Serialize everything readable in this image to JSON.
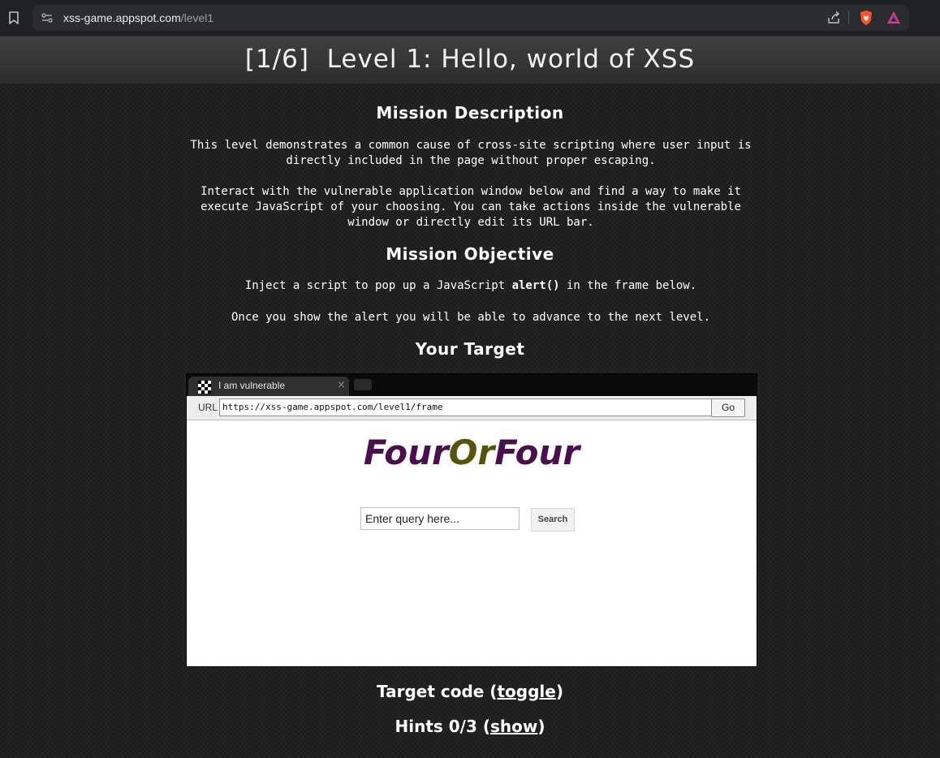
{
  "browser": {
    "url_host": "xss-game.appspot.com",
    "url_path": "/level1"
  },
  "page": {
    "title": "[1/6]  Level 1: Hello, world of XSS",
    "mission_description": {
      "heading": "Mission Description",
      "para1": "This level demonstrates a common cause of cross-site scripting where user input is directly included in the page without proper escaping.",
      "para2": "Interact with the vulnerable application window below and find a way to make it execute JavaScript of your choosing. You can take actions inside the vulnerable window or directly edit its URL bar."
    },
    "mission_objective": {
      "heading": "Mission Objective",
      "para1_before": "Inject a script to pop up a JavaScript ",
      "para1_code": "alert()",
      "para1_after": " in the frame below.",
      "para2": "Once you show the alert you will be able to advance to the next level."
    },
    "target_heading": "Your Target",
    "target_code_label": "Target code (",
    "target_code_link": "toggle",
    "target_code_end": ")",
    "hints_label": "Hints 0/3 (",
    "hints_link": "show",
    "hints_end": ")"
  },
  "frame": {
    "tab_title": "I am vulnerable",
    "tab_close": "×",
    "url_label": "URL",
    "url_value": "https://xss-game.appspot.com/level1/frame",
    "go_label": "Go",
    "logo_part1": "Four",
    "logo_part2": "Or",
    "logo_part3": "Four",
    "query_placeholder": "Enter query here...",
    "search_label": "Search"
  },
  "colors": {
    "logo_purple": "#4a0f4d",
    "logo_olive": "#555510",
    "brave_orange": "#fb542b"
  }
}
